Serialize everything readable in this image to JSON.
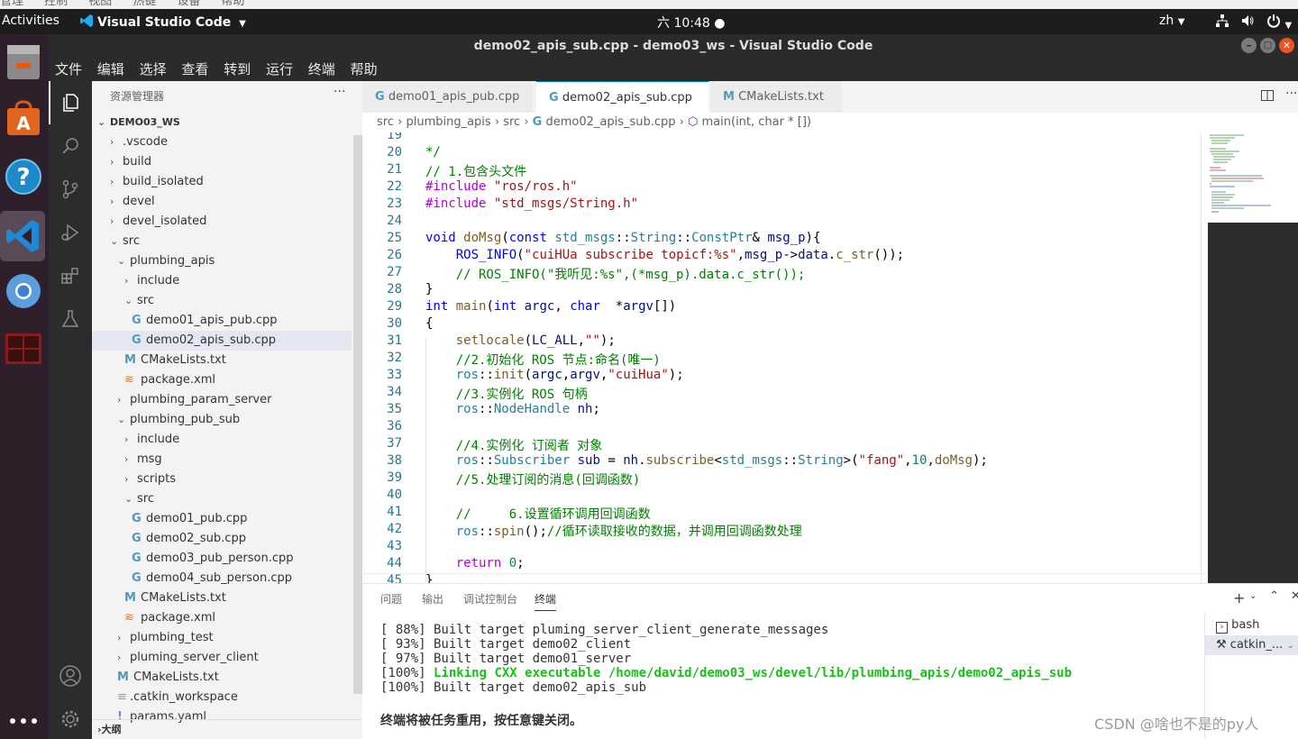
{
  "system": {
    "hidden_menu": [
      "管理",
      "控制",
      "视图",
      "热键",
      "设备",
      "帮助"
    ],
    "activities": "Activities",
    "app_name": "Visual Studio Code",
    "clock": "六 10:48",
    "lang": "zh"
  },
  "window": {
    "title": "demo02_apis_sub.cpp - demo03_ws - Visual Studio Code"
  },
  "menu": [
    "文件",
    "编辑",
    "选择",
    "查看",
    "转到",
    "运行",
    "终端",
    "帮助"
  ],
  "launcher": [
    {
      "icon": "files-icon"
    },
    {
      "icon": "software-center-icon"
    },
    {
      "icon": "help-icon"
    },
    {
      "icon": "vscode-icon"
    },
    {
      "icon": "chromium-icon"
    },
    {
      "icon": "terminal-icon"
    },
    {
      "icon": "show-apps-icon"
    }
  ],
  "sidebar": {
    "header": "资源管理器",
    "more": "···",
    "root": "DEMO03_WS",
    "outline": "大纲",
    "items": [
      {
        "label": ".vscode",
        "depth": 1,
        "type": "folder",
        "open": false
      },
      {
        "label": "build",
        "depth": 1,
        "type": "folder",
        "open": false
      },
      {
        "label": "build_isolated",
        "depth": 1,
        "type": "folder",
        "open": false
      },
      {
        "label": "devel",
        "depth": 1,
        "type": "folder",
        "open": false
      },
      {
        "label": "devel_isolated",
        "depth": 1,
        "type": "folder",
        "open": false
      },
      {
        "label": "src",
        "depth": 1,
        "type": "folder",
        "open": true
      },
      {
        "label": "plumbing_apis",
        "depth": 2,
        "type": "folder",
        "open": true
      },
      {
        "label": "include",
        "depth": 3,
        "type": "folder",
        "open": false
      },
      {
        "label": "src",
        "depth": 3,
        "type": "folder",
        "open": true
      },
      {
        "label": "demo01_apis_pub.cpp",
        "depth": 4,
        "type": "cpp"
      },
      {
        "label": "demo02_apis_sub.cpp",
        "depth": 4,
        "type": "cpp",
        "selected": true
      },
      {
        "label": "CMakeLists.txt",
        "depth": 3,
        "type": "cmake"
      },
      {
        "label": "package.xml",
        "depth": 3,
        "type": "xml"
      },
      {
        "label": "plumbing_param_server",
        "depth": 2,
        "type": "folder",
        "open": false
      },
      {
        "label": "plumbing_pub_sub",
        "depth": 2,
        "type": "folder",
        "open": true
      },
      {
        "label": "include",
        "depth": 3,
        "type": "folder",
        "open": false
      },
      {
        "label": "msg",
        "depth": 3,
        "type": "folder",
        "open": false
      },
      {
        "label": "scripts",
        "depth": 3,
        "type": "folder",
        "open": false
      },
      {
        "label": "src",
        "depth": 3,
        "type": "folder",
        "open": true
      },
      {
        "label": "demo01_pub.cpp",
        "depth": 4,
        "type": "cpp"
      },
      {
        "label": "demo02_sub.cpp",
        "depth": 4,
        "type": "cpp"
      },
      {
        "label": "demo03_pub_person.cpp",
        "depth": 4,
        "type": "cpp"
      },
      {
        "label": "demo04_sub_person.cpp",
        "depth": 4,
        "type": "cpp"
      },
      {
        "label": "CMakeLists.txt",
        "depth": 3,
        "type": "cmake"
      },
      {
        "label": "package.xml",
        "depth": 3,
        "type": "xml"
      },
      {
        "label": "plumbing_test",
        "depth": 2,
        "type": "folder",
        "open": false
      },
      {
        "label": "pluming_server_client",
        "depth": 2,
        "type": "folder",
        "open": false
      },
      {
        "label": "CMakeLists.txt",
        "depth": 2,
        "type": "cmake"
      },
      {
        "label": ".catkin_workspace",
        "depth": 2,
        "type": "plain"
      },
      {
        "label": "params.yaml",
        "depth": 2,
        "type": "yaml"
      }
    ]
  },
  "tabs": [
    {
      "label": "demo01_apis_pub.cpp",
      "icon": "cpp-icon"
    },
    {
      "label": "demo02_apis_sub.cpp",
      "icon": "cpp-icon",
      "active": true
    },
    {
      "label": "CMakeLists.txt",
      "icon": "cmake-icon"
    }
  ],
  "breadcrumb": [
    "src",
    "plumbing_apis",
    "src",
    "demo02_apis_sub.cpp",
    "main(int, char * [])"
  ],
  "code": {
    "lines": [
      {
        "n": "19",
        "html": ""
      },
      {
        "n": "20",
        "html": "<span class='c'>*/</span>"
      },
      {
        "n": "21",
        "html": "<span class='c'>// 1.包含头文件</span>"
      },
      {
        "n": "22",
        "html": "<span class='p'>#include</span> <span class='s'>\"ros/ros.h\"</span>"
      },
      {
        "n": "23",
        "html": "<span class='p'>#include</span> <span class='s'>\"std_msgs/String.h\"</span>"
      },
      {
        "n": "24",
        "html": ""
      },
      {
        "n": "25",
        "html": "<span class='k'>void</span> <span class='f'>doMsg</span>(<span class='k'>const</span> <span class='t'>std_msgs</span>::<span class='t'>String</span>::<span class='t'>ConstPtr</span>&amp; <span class='v'>msg_p</span>){"
      },
      {
        "n": "26",
        "html": "    <span class='k'>ROS_INFO</span>(<span class='s'>\"cuiHUa subscribe topicf:%s\"</span>,<span class='v'>msg_p</span>-&gt;<span class='v'>data</span>.<span class='f'>c_str</span>());"
      },
      {
        "n": "27",
        "html": "    <span class='c'>// ROS_INFO(\"我听见:%s\",(*msg_p).data.c_str());</span>"
      },
      {
        "n": "28",
        "html": "}"
      },
      {
        "n": "29",
        "html": "<span class='k'>int</span> <span class='f'>main</span>(<span class='k'>int</span> <span class='v'>argc</span>, <span class='k'>char</span>  *<span class='v'>argv</span>[])"
      },
      {
        "n": "30",
        "html": "{"
      },
      {
        "n": "31",
        "html": "    <span class='f'>setlocale</span>(<span class='v'>LC_ALL</span>,<span class='s'>\"\"</span>);"
      },
      {
        "n": "32",
        "html": "    <span class='c'>//2.初始化 ROS 节点:命名(唯一)</span>"
      },
      {
        "n": "33",
        "html": "    <span class='t'>ros</span>::<span class='f'>init</span>(<span class='v'>argc</span>,<span class='v'>argv</span>,<span class='s'>\"cuiHua\"</span>);"
      },
      {
        "n": "34",
        "html": "    <span class='c'>//3.实例化 ROS 句柄</span>"
      },
      {
        "n": "35",
        "html": "    <span class='t'>ros</span>::<span class='t'>NodeHandle</span> <span class='v'>nh</span>;"
      },
      {
        "n": "36",
        "html": ""
      },
      {
        "n": "37",
        "html": "    <span class='c'>//4.实例化 订阅者 对象</span>"
      },
      {
        "n": "38",
        "html": "    <span class='t'>ros</span>::<span class='t'>Subscriber</span> <span class='v'>sub</span> = <span class='v'>nh</span>.<span class='f'>subscribe</span>&lt;<span class='t'>std_msgs</span>::<span class='t'>String</span>&gt;(<span class='s'>\"fang\"</span>,<span class='n'>10</span>,<span class='f'>doMsg</span>);"
      },
      {
        "n": "39",
        "html": "    <span class='c'>//5.处理订阅的消息(回调函数)</span>"
      },
      {
        "n": "40",
        "html": ""
      },
      {
        "n": "41",
        "html": "    <span class='c'>//     6.设置循环调用回调函数</span>"
      },
      {
        "n": "42",
        "html": "    <span class='t'>ros</span>::<span class='f'>spin</span>();<span class='c'>//循环读取接收的数据，并调用回调函数处理</span>"
      },
      {
        "n": "43",
        "html": ""
      },
      {
        "n": "44",
        "html": "    <span class='p'>return</span> <span class='n'>0</span>;"
      },
      {
        "n": "45",
        "html": "}"
      }
    ]
  },
  "panel": {
    "tabs": [
      "问题",
      "输出",
      "调试控制台",
      "终端"
    ],
    "active_tab": "终端",
    "terminals": [
      "bash",
      "catkin_..."
    ],
    "output": [
      {
        "text": "[ 88%] Built target pluming_server_client_generate_messages",
        "green": false
      },
      {
        "text": "[ 93%] Built target demo02_client",
        "green": false
      },
      {
        "text": "[ 97%] Built target demo01_server",
        "green": false
      },
      {
        "prefix": "[100%] ",
        "text": "Linking CXX executable /home/david/demo03_ws/devel/lib/plumbing_apis/demo02_apis_sub",
        "green": true
      },
      {
        "text": "[100%] Built target demo02_apis_sub",
        "green": false
      }
    ],
    "footer": "终端将被任务重用，按任意键关闭。",
    "watermark": "CSDN @啥也不是的py人"
  },
  "colors": {
    "accent": "#007acc",
    "green_output": "#19c019",
    "launcher_bg": "#2e1f2b"
  }
}
